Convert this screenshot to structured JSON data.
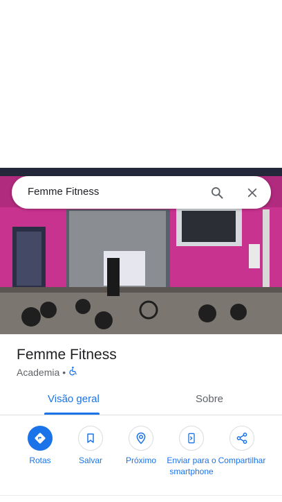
{
  "search": {
    "query": "Femme Fitness"
  },
  "place": {
    "name": "Femme Fitness",
    "category": "Academia",
    "separator": "•"
  },
  "tabs": [
    {
      "label": "Visão geral",
      "active": true
    },
    {
      "label": "Sobre",
      "active": false
    }
  ],
  "actions": [
    {
      "label": "Rotas",
      "icon": "directions-icon"
    },
    {
      "label": "Salvar",
      "icon": "bookmark-icon"
    },
    {
      "label": "Próximo",
      "icon": "nearby-icon"
    },
    {
      "label": "Enviar para o smartphone",
      "icon": "send-to-phone-icon"
    },
    {
      "label": "Compartilhar",
      "icon": "share-icon"
    }
  ],
  "colors": {
    "accent": "#1a73e8",
    "text": "#202124",
    "secondary": "#5f6368",
    "wall": "#c8338f"
  }
}
